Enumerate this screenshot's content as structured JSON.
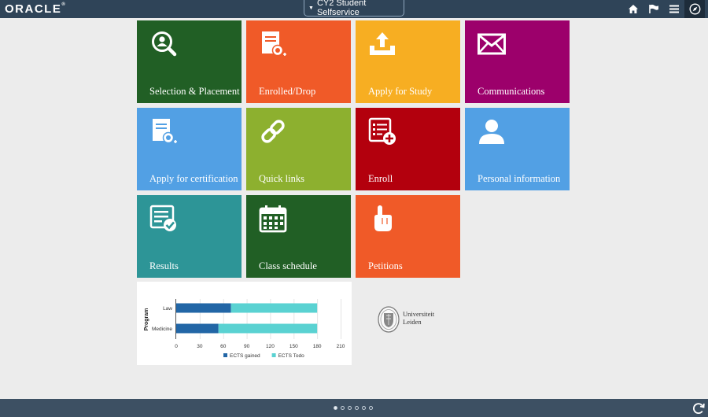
{
  "header": {
    "logo": "ORACLE",
    "logo_mark": "®",
    "homepage_title": "CY2 Student Selfservice",
    "icons": [
      "home-icon",
      "flag-icon",
      "menu-icon",
      "navbar-compass-icon"
    ]
  },
  "tiles": [
    {
      "label": "Selection & Placement",
      "color": "#215f25",
      "icon": "search-person-icon"
    },
    {
      "label": "Enrolled/Drop",
      "color": "#f05a28",
      "icon": "certificate-icon"
    },
    {
      "label": "Apply for Study",
      "color": "#f7ae22",
      "icon": "upload-icon"
    },
    {
      "label": "Communications",
      "color": "#9c006b",
      "icon": "envelope-icon"
    },
    {
      "label": "Apply for certification",
      "color": "#52a0e4",
      "icon": "certificate-icon"
    },
    {
      "label": "Quick links",
      "color": "#8db02f",
      "icon": "link-icon"
    },
    {
      "label": "Enroll",
      "color": "#b3000d",
      "icon": "list-add-icon"
    },
    {
      "label": "Personal information",
      "color": "#52a0e4",
      "icon": "person-icon"
    },
    {
      "label": "Results",
      "color": "#2d9597",
      "icon": "checklist-icon"
    },
    {
      "label": "Class schedule",
      "color": "#215f25",
      "icon": "calendar-icon"
    },
    {
      "label": "Petitions",
      "color": "#f05a28",
      "icon": "raised-hand-icon"
    }
  ],
  "chart_data": {
    "type": "bar",
    "orientation": "horizontal",
    "stacked": true,
    "categories": [
      "Law",
      "Medicine"
    ],
    "series": [
      {
        "name": "ECTS gained",
        "values": [
          70,
          54
        ],
        "color": "#2266a6"
      },
      {
        "name": "ECTS Todo",
        "values": [
          110,
          126
        ],
        "color": "#5ad2d2"
      }
    ],
    "ylabel": "Program",
    "xlabel": "",
    "xlim": [
      0,
      210
    ],
    "xticks": [
      0,
      30,
      60,
      90,
      120,
      150,
      180,
      210
    ],
    "grid": true,
    "legend": "bottom"
  },
  "university": {
    "line1": "Universiteit",
    "line2": "Leiden"
  },
  "footer": {
    "page_count": 6,
    "active_page": 1,
    "icons": [
      "refresh-icon"
    ]
  }
}
